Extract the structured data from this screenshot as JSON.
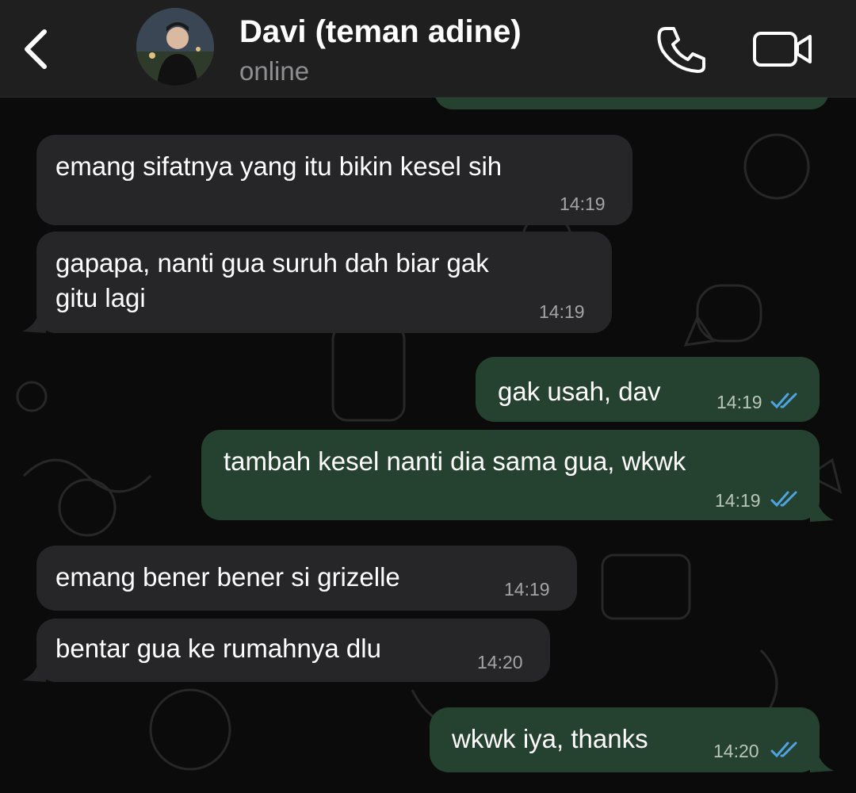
{
  "header": {
    "contact_name": "Davi (teman adine)",
    "status": "online",
    "back_icon": "chevron-left-icon",
    "call_icon": "phone-icon",
    "video_icon": "video-camera-icon"
  },
  "colors": {
    "incoming_bubble": "#262628",
    "outgoing_bubble": "#25412f",
    "read_ticks": "#4fa3e0",
    "header_bg": "#1f1f1f"
  },
  "messages": [
    {
      "direction": "in",
      "text": "emang sifatnya yang itu bikin kesel sih",
      "time": "14:19"
    },
    {
      "direction": "in",
      "text_line1": "gapapa, nanti gua suruh dah biar gak",
      "text_line2": "gitu lagi",
      "time": "14:19"
    },
    {
      "direction": "out",
      "text": "gak usah, dav",
      "time": "14:19",
      "status": "read"
    },
    {
      "direction": "out",
      "text": "tambah kesel nanti dia sama gua, wkwk",
      "time": "14:19",
      "status": "read"
    },
    {
      "direction": "in",
      "text": "emang bener bener si grizelle",
      "time": "14:19"
    },
    {
      "direction": "in",
      "text": "bentar gua ke rumahnya dlu",
      "time": "14:20"
    },
    {
      "direction": "out",
      "text": "wkwk iya, thanks",
      "time": "14:20",
      "status": "read"
    }
  ]
}
